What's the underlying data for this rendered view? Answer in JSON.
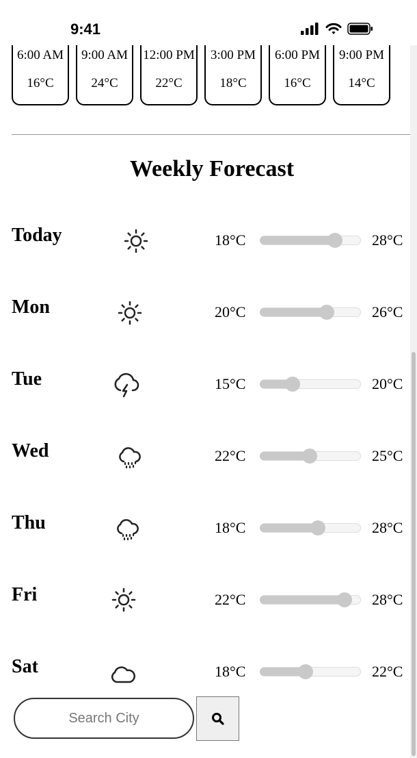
{
  "status_bar": {
    "time": "9:41"
  },
  "hourly": [
    {
      "time": "6:00 AM",
      "temp": "16°C"
    },
    {
      "time": "9:00 AM",
      "temp": "24°C"
    },
    {
      "time": "12:00 PM",
      "temp": "22°C"
    },
    {
      "time": "3:00 PM",
      "temp": "18°C"
    },
    {
      "time": "6:00 PM",
      "temp": "16°C"
    },
    {
      "time": "9:00 PM",
      "temp": "14°C"
    }
  ],
  "weekly": {
    "title": "Weekly Forecast",
    "days": [
      {
        "name": "Today",
        "icon": "sun-icon",
        "min": "18°C",
        "max": "28°C",
        "level": 0.75
      },
      {
        "name": "Mon",
        "icon": "sun-icon",
        "min": "20°C",
        "max": "26°C",
        "level": 0.67
      },
      {
        "name": "Tue",
        "icon": "thunderstorm-icon",
        "min": "15°C",
        "max": "20°C",
        "level": 0.33
      },
      {
        "name": "Wed",
        "icon": "rain-cloud-icon",
        "min": "22°C",
        "max": "25°C",
        "level": 0.5
      },
      {
        "name": "Thu",
        "icon": "rain-cloud-icon",
        "min": "18°C",
        "max": "28°C",
        "level": 0.58
      },
      {
        "name": "Fri",
        "icon": "sun-icon",
        "min": "22°C",
        "max": "28°C",
        "level": 0.85
      },
      {
        "name": "Sat",
        "icon": "cloud-icon",
        "min": "18°C",
        "max": "22°C",
        "level": 0.46
      }
    ]
  },
  "search": {
    "placeholder": "Search City",
    "button_icon": "search-icon"
  }
}
